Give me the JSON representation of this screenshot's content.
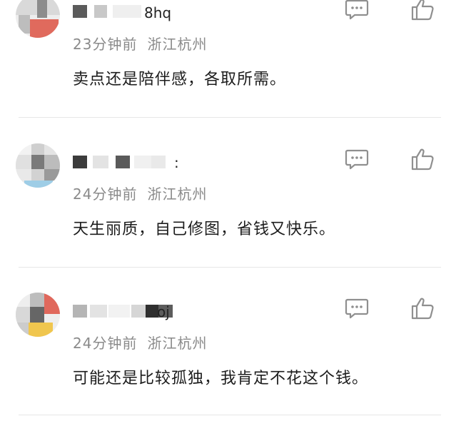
{
  "comments": [
    {
      "username_visible": "8hq",
      "time": "23分钟前",
      "location": "浙江杭州",
      "text": "卖点还是陪伴感，各取所需。"
    },
    {
      "username_visible": ":",
      "time": "24分钟前",
      "location": "浙江杭州",
      "text": "天生丽质，自己修图，省钱又快乐。"
    },
    {
      "username_visible": "oj",
      "time": "24分钟前",
      "location": "浙江杭州",
      "text": "可能还是比较孤独，我肯定不花这个钱。"
    }
  ],
  "icons": {
    "reply": "comment-bubble-icon",
    "like": "thumbs-up-icon"
  },
  "colors": {
    "meta_text": "#8a8a8a",
    "body_text": "#1c1c1c",
    "icon_stroke": "#8f8f8f",
    "divider": "#e6e6e6"
  }
}
